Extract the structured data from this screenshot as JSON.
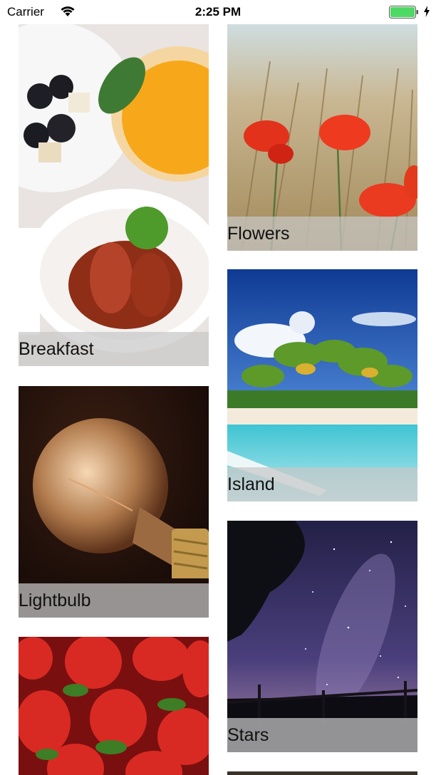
{
  "status_bar": {
    "carrier": "Carrier",
    "time": "2:25 PM",
    "battery_color": "#4cd964"
  },
  "gallery": {
    "items": [
      {
        "caption": "Breakfast"
      },
      {
        "caption": "Flowers"
      },
      {
        "caption": "Island"
      },
      {
        "caption": "Lightbulb"
      },
      {
        "caption": "Stars"
      },
      {
        "caption": ""
      },
      {
        "caption": ""
      }
    ]
  }
}
